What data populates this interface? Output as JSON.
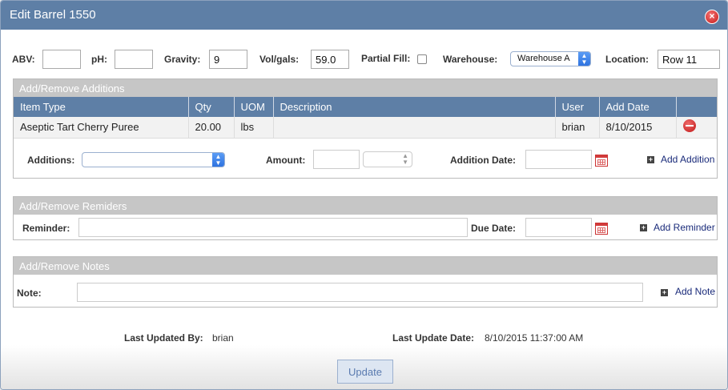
{
  "dialog": {
    "title": "Edit Barrel 1550"
  },
  "fields": {
    "abv_label": "ABV:",
    "abv_value": "",
    "ph_label": "pH:",
    "ph_value": "",
    "gravity_label": "Gravity:",
    "gravity_value": "9",
    "volgals_label": "Vol/gals:",
    "volgals_value": "59.0",
    "partial_fill_label": "Partial Fill:",
    "partial_fill_checked": false,
    "warehouse_label": "Warehouse:",
    "warehouse_value": "Warehouse A",
    "location_label": "Location:",
    "location_value": "Row 11"
  },
  "additions": {
    "header": "Add/Remove Additions",
    "columns": [
      "Item Type",
      "Qty",
      "UOM",
      "Description",
      "User",
      "Add Date",
      ""
    ],
    "rows": [
      {
        "item_type": "Aseptic Tart Cherry Puree",
        "qty": "20.00",
        "uom": "lbs",
        "description": "",
        "user": "brian",
        "add_date": "8/10/2015"
      }
    ],
    "additions_label": "Additions:",
    "amount_label": "Amount:",
    "addition_date_label": "Addition Date:",
    "add_link": "Add Addition"
  },
  "reminders": {
    "header": "Add/Remove Remiders",
    "reminder_label": "Reminder:",
    "due_date_label": "Due Date:",
    "add_link": "Add Reminder"
  },
  "notes": {
    "header": "Add/Remove Notes",
    "note_label": "Note:",
    "add_link": "Add Note"
  },
  "footer": {
    "last_updated_by_label": "Last Updated By:",
    "last_updated_by": "brian",
    "last_update_date_label": "Last Update Date:",
    "last_update_date": "8/10/2015 11:37:00 AM",
    "update_button": "Update"
  },
  "colors": {
    "header_blue": "#5e7fa6",
    "panel_gray": "#c6c6c6",
    "remove_red": "#c01818"
  },
  "icons": [
    "close-icon",
    "remove-icon",
    "calendar-icon",
    "plus-icon",
    "chevron-updown-icon"
  ]
}
